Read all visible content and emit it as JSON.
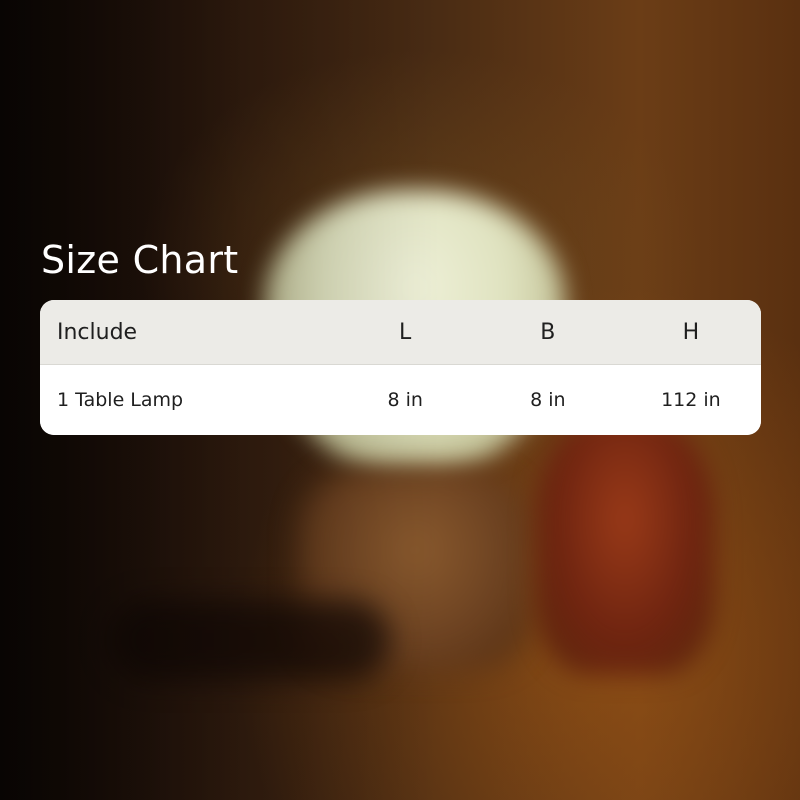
{
  "title": "Size Chart",
  "table": {
    "headers": [
      "Include",
      "L",
      "B",
      "H"
    ],
    "rows": [
      [
        "1 Table Lamp",
        "8 in",
        "8 in",
        "112 in"
      ]
    ]
  },
  "colors": {
    "header_bg": "#ecebe7",
    "card_bg": "#ffffff",
    "title_text": "#ffffff",
    "cell_text": "#1f1f1f"
  }
}
